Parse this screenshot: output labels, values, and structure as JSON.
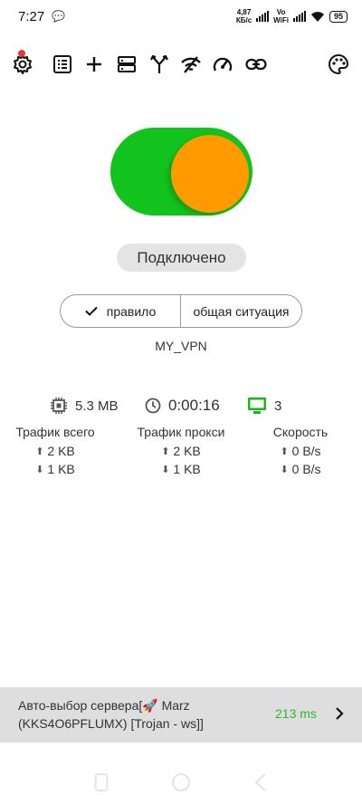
{
  "status_bar": {
    "time": "7:27",
    "net_speed_value": "4,87",
    "net_speed_unit": "КБ/с",
    "volte_top": "Vo",
    "volte_bottom": "WiFi",
    "battery": "95"
  },
  "toolbar": {
    "icons": [
      "gear-icon",
      "list-icon",
      "plus-icon",
      "servers-icon",
      "fork-icon",
      "wifi-slash-icon",
      "speedometer-icon",
      "link-icon",
      "palette-icon"
    ]
  },
  "main": {
    "connection_status": "Подключено",
    "mode_rule_label": "правило",
    "mode_global_label": "общая ситуация",
    "profile_name": "MY_VPN"
  },
  "stats": {
    "memory": "5.3 MB",
    "uptime": "0:00:16",
    "connections": "3",
    "columns": [
      {
        "title": "Трафик всего",
        "up": "2 KB",
        "down": "1 KB"
      },
      {
        "title": "Трафик прокси",
        "up": "2 KB",
        "down": "1 KB"
      },
      {
        "title": "Скорость",
        "up": "0 B/s",
        "down": "0 B/s"
      }
    ]
  },
  "server_bar": {
    "line1": "Авто-выбор сервера[🚀 Marz",
    "line2": "(KKS4O6PFLUMX) [Trojan - ws]]",
    "ping": "213 ms"
  },
  "colors": {
    "toggle_track": "#13c31d",
    "toggle_knob": "#ff9a00",
    "ping": "#2bb82b",
    "connections_icon": "#16b81c"
  }
}
